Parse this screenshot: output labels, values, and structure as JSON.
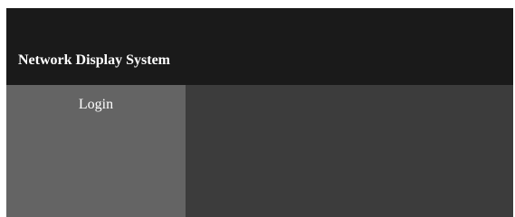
{
  "header": {
    "title": "Network Display System"
  },
  "sidebar": {
    "items": [
      {
        "label": "Login"
      }
    ]
  },
  "colors": {
    "header_bg": "#1a1a1a",
    "sidebar_bg": "#646464",
    "main_bg": "#3c3c3c",
    "text": "#ffffff"
  }
}
